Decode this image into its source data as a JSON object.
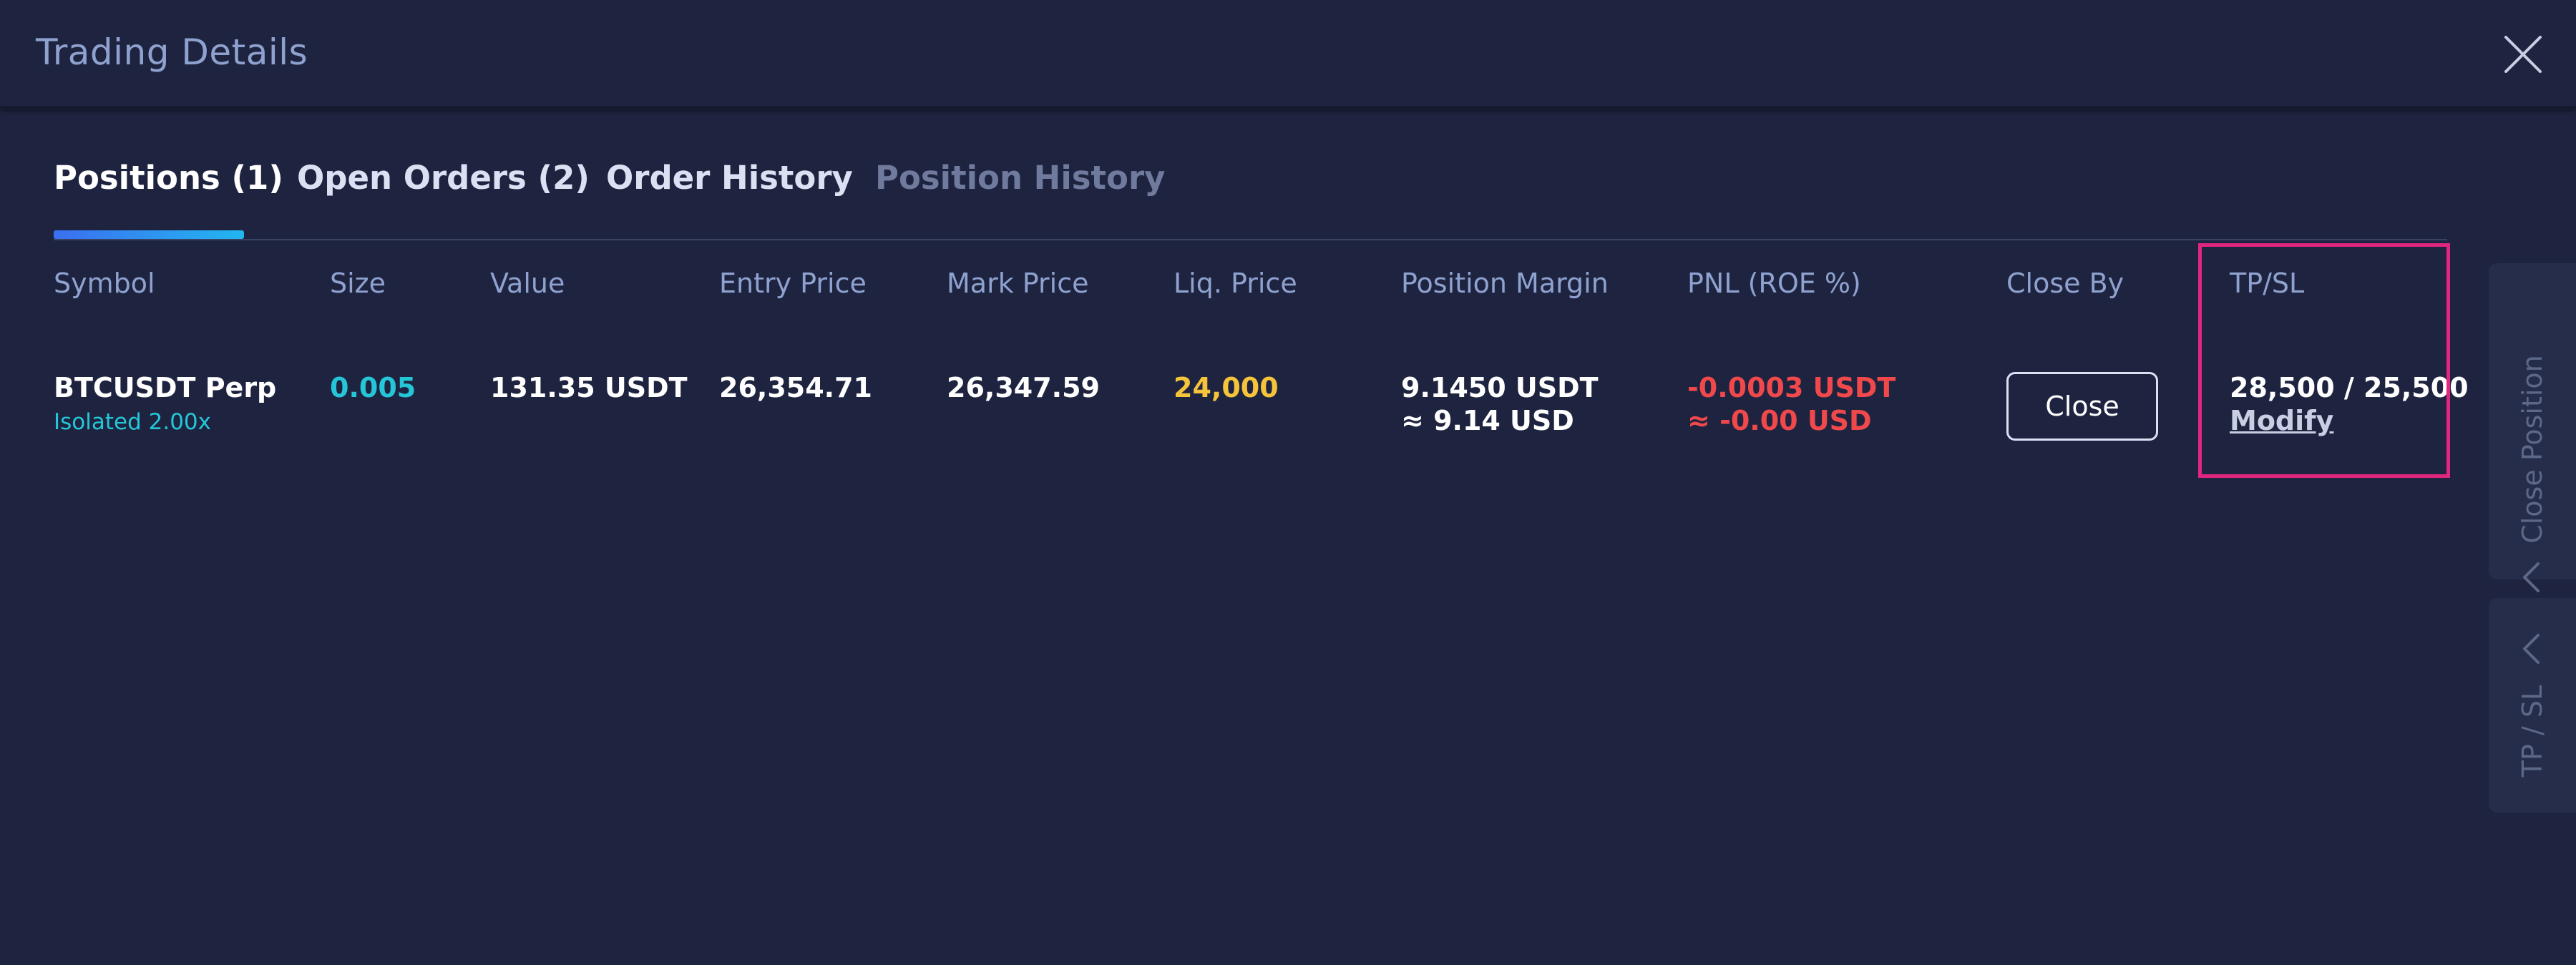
{
  "header": {
    "title": "Trading Details"
  },
  "tabs": [
    {
      "label": "Positions (1)",
      "state": "active"
    },
    {
      "label": "Open Orders (2)",
      "state": "normal"
    },
    {
      "label": "Order History",
      "state": "normal"
    },
    {
      "label": "Position History",
      "state": "dim"
    }
  ],
  "table": {
    "headers": [
      "Symbol",
      "Size",
      "Value",
      "Entry Price",
      "Mark Price",
      "Liq. Price",
      "Position Margin",
      "PNL (ROE %)",
      "Close By",
      "TP/SL"
    ],
    "row": {
      "symbol": "BTCUSDT Perp",
      "mode": "Isolated 2.00x",
      "size": "0.005",
      "value": "131.35 USDT",
      "entry_price": "26,354.71",
      "mark_price": "26,347.59",
      "liq_price": "24,000",
      "position_margin": "9.1450 USDT",
      "position_margin_usd": "≈ 9.14 USD",
      "pnl": "-0.0003 USDT",
      "pnl_usd": "≈ -0.00 USD",
      "close_by_button": "Close",
      "tpsl": "28,500 / 25,500",
      "tpsl_modify": "Modify"
    }
  },
  "side_tabs": [
    {
      "label": "Close Position",
      "icon": "chevron-left-icon"
    },
    {
      "label": "TP / SL",
      "icon": "chevron-left-icon"
    }
  ],
  "colors": {
    "background": "#1e2440",
    "header_text": "#8fa2cf",
    "teal": "#25c6d8",
    "yellow": "#f5c43b",
    "red": "#f0484b",
    "highlight": "#e0267f",
    "tab_gradient_start": "#3b6ff0",
    "tab_gradient_end": "#22b6f0"
  }
}
